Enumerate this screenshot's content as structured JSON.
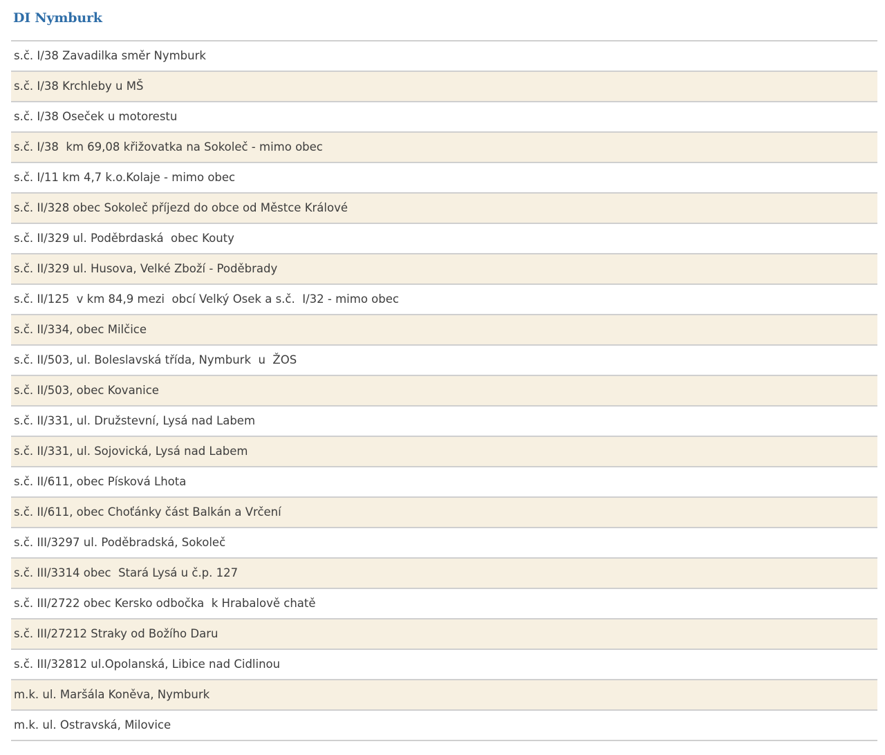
{
  "heading": "DI Nymburk",
  "rows": [
    "s.č. I/38 Zavadilka směr Nymburk",
    "s.č. I/38 Krchleby u MŠ",
    "s.č. I/38 Oseček u motorestu",
    "s.č. I/38  km 69,08 křižovatka na Sokoleč - mimo obec",
    "s.č. I/11 km 4,7 k.o.Kolaje - mimo obec",
    "s.č. II/328 obec Sokoleč příjezd do obce od Městce Králové",
    "s.č. II/329 ul. Poděbrdaská  obec Kouty",
    "s.č. II/329 ul. Husova, Velké Zboží - Poděbrady",
    "s.č. II/125  v km 84,9 mezi  obcí Velký Osek a s.č.  I/32 - mimo obec",
    "s.č. II/334, obec Milčice",
    "s.č. II/503, ul. Boleslavská třída, Nymburk  u  ŽOS",
    "s.č. II/503, obec Kovanice",
    "s.č. II/331, ul. Družstevní, Lysá nad Labem",
    "s.č. II/331, ul. Sojovická, Lysá nad Labem",
    "s.č. II/611, obec Písková Lhota",
    "s.č. II/611, obec Choťánky část Balkán a Vrčení",
    "s.č. III/3297 ul. Poděbradská, Sokoleč",
    "s.č. III/3314 obec  Stará Lysá u č.p. 127",
    "s.č. III/2722 obec Kersko odbočka  k Hrabalově chatě",
    "s.č. III/27212 Straky od Božího Daru",
    "s.č. III/32812 ul.Opolanská, Libice nad Cidlinou",
    "m.k. ul. Maršála Koněva, Nymburk",
    "m.k. ul. Ostravská, Milovice"
  ]
}
